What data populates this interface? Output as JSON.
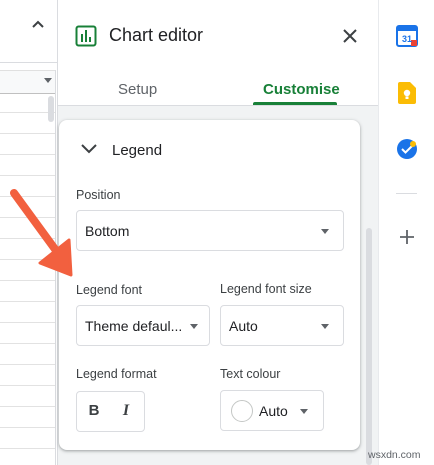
{
  "panel": {
    "title": "Chart editor",
    "close_icon": "close-icon",
    "chart_icon": "chart-icon",
    "tabs": [
      {
        "label": "Setup",
        "active": false
      },
      {
        "label": "Customise",
        "active": true
      }
    ],
    "accent_color": "#188038"
  },
  "legend_section": {
    "title": "Legend",
    "expanded": true,
    "position": {
      "label": "Position",
      "value": "Bottom"
    },
    "font": {
      "label": "Legend font",
      "value": "Theme defaul..."
    },
    "font_size": {
      "label": "Legend font size",
      "value": "Auto"
    },
    "format": {
      "label": "Legend format",
      "bold": "B",
      "italic": "I"
    },
    "text_colour": {
      "label": "Text colour",
      "value": "Auto",
      "swatch": "#ffffff"
    }
  },
  "side_panel": {
    "icons": [
      "calendar-icon",
      "keep-icon",
      "tasks-icon",
      "add-icon"
    ],
    "calendar_day": "31",
    "add_symbol": "+"
  },
  "annotation": {
    "arrow_color": "#f2603f"
  },
  "watermark": "wsxdn.com"
}
